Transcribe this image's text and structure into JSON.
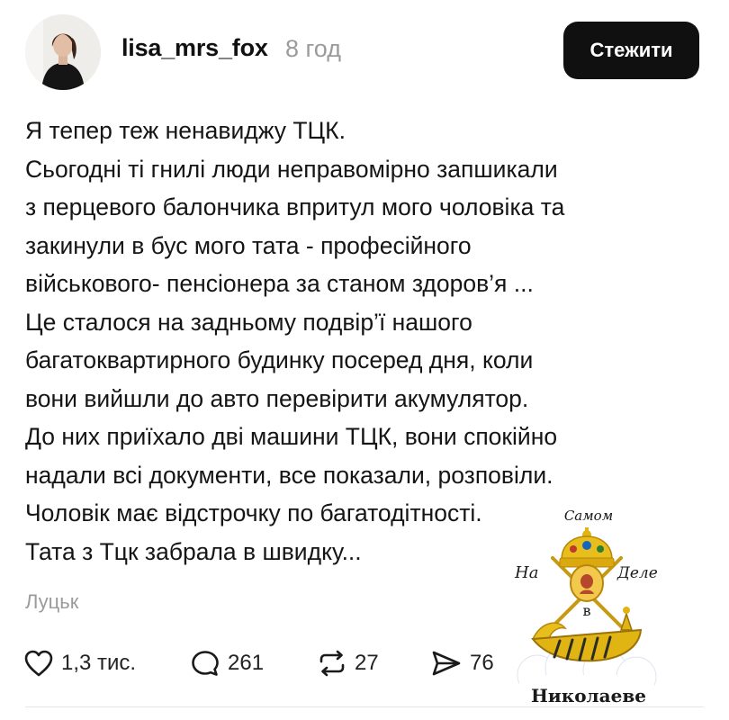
{
  "post": {
    "author": "lisa_mrs_fox",
    "time": "8 год",
    "follow_label": "Стежити",
    "lines": [
      "Я тепер теж ненавиджу ТЦК.",
      "Сьогодні ті гнилі люди неправомірно запшикали",
      "з перцевого балончика впритул мого чоловіка та",
      "закинули в бус мого тата - професійного",
      "військового-  пенсіонера за станом здоров’я ...",
      "Це сталося на задньому подвір’ї нашого",
      "багатоквартирного будинку посеред дня, коли",
      "вони вийшли до авто перевірити акумулятор.",
      "До них приїхало дві машини ТЦК, вони спокійно",
      "надали всі документи, все показали, розповіли.",
      "Чоловік має відстрочку по багатодітності.",
      "Тата з Тцк забрала в швидку..."
    ],
    "location": "Луцьк"
  },
  "actions": {
    "likes": "1,3 тис.",
    "comments": "261",
    "reposts": "27",
    "shares": "76"
  },
  "watermark": {
    "top": "Самом",
    "left": "На",
    "right": "Деле",
    "middle": "в",
    "bottom": "Николаеве"
  },
  "colors": {
    "follow_button_bg": "#101010",
    "muted_text": "#9b9b9b",
    "watermark_gold": "#e0b412"
  }
}
